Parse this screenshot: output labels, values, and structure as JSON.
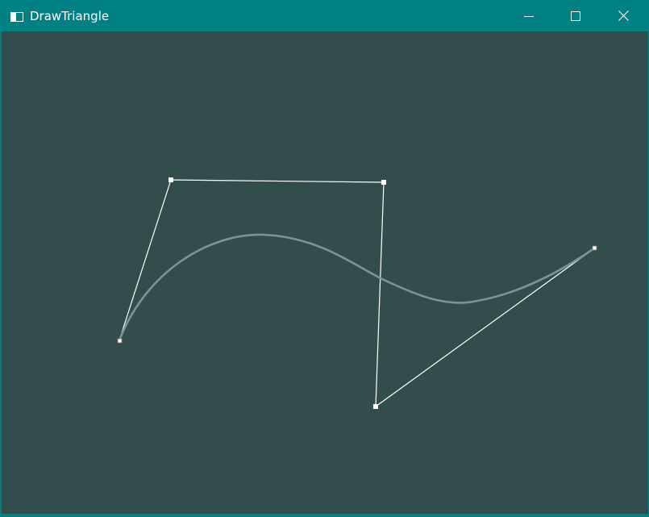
{
  "window": {
    "title": "DrawTriangle",
    "titlebar_color": "#018183",
    "clear_color": "#334d4d",
    "icons": {
      "app": "app-window-icon",
      "minimize": "minimize-icon",
      "maximize": "maximize-icon",
      "close": "close-icon"
    }
  },
  "scene": {
    "curve_type": "cubic-bezier",
    "control_polygon_color": "#ffffff",
    "curve_color": "#7d939a",
    "control_point_count": 4
  }
}
